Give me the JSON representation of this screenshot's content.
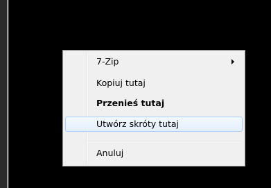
{
  "context_menu": {
    "items": [
      {
        "label": "7-Zip",
        "has_submenu": true,
        "icon": "submenu-arrow-icon"
      },
      {
        "label": "Kopiuj tutaj"
      },
      {
        "label": "Przenieś tutaj",
        "bold": true
      },
      {
        "label": "Utwórz skróty tutaj",
        "highlighted": true
      },
      {
        "label": "Anuluj"
      }
    ]
  },
  "colors": {
    "background": "#000000",
    "menu_background": "#f0f0f0",
    "menu_border": "#979797",
    "highlight_border": "#aecff7",
    "highlight_fill": "#e4effd"
  }
}
